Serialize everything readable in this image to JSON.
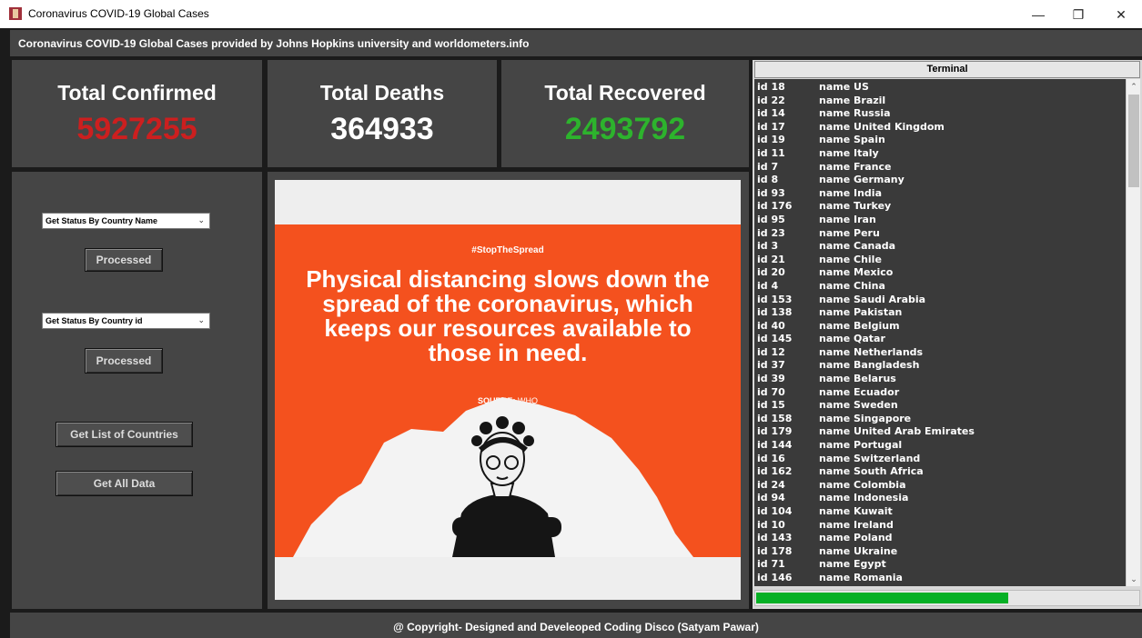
{
  "window": {
    "title": "Coronavirus COVID-19 Global Cases",
    "minimize_glyph": "—",
    "maximize_glyph": "❐",
    "close_glyph": "✕"
  },
  "header": {
    "text": "Coronavirus COVID-19 Global Cases  provided by Johns Hopkins university and worldometers.info"
  },
  "stats": {
    "confirmed": {
      "label": "Total Confirmed",
      "value": "5927255",
      "color": "#cc1f1f"
    },
    "deaths": {
      "label": "Total Deaths",
      "value": "364933",
      "color": "#ffffff"
    },
    "recovered": {
      "label": "Total Recovered",
      "value": "2493792",
      "color": "#2db32d"
    }
  },
  "controls": {
    "country_name_select": "Get Status By Country Name",
    "country_id_select": "Get Status By Country id",
    "processed_label": "Processed",
    "list_countries_label": "Get List of Countries",
    "all_data_label": "Get All Data"
  },
  "poster": {
    "tag": "#StopTheSpread",
    "headline": "Physical distancing slows down the spread of the coronavirus, which keeps our resources available to those in need.",
    "source_label": "SOURCE:",
    "source_value": "WHO"
  },
  "terminal": {
    "title": "Terminal",
    "rows": [
      {
        "id": "id 18",
        "name": "name US"
      },
      {
        "id": "id 22",
        "name": "name Brazil"
      },
      {
        "id": "id 14",
        "name": "name Russia"
      },
      {
        "id": "id 17",
        "name": "name United Kingdom"
      },
      {
        "id": "id 19",
        "name": "name Spain"
      },
      {
        "id": "id 11",
        "name": "name Italy"
      },
      {
        "id": "id 7",
        "name": "name France"
      },
      {
        "id": "id 8",
        "name": "name Germany"
      },
      {
        "id": "id 93",
        "name": "name India"
      },
      {
        "id": "id 176",
        "name": "name Turkey"
      },
      {
        "id": "id 95",
        "name": "name Iran"
      },
      {
        "id": "id 23",
        "name": "name Peru"
      },
      {
        "id": "id 3",
        "name": "name Canada"
      },
      {
        "id": "id 21",
        "name": "name Chile"
      },
      {
        "id": "id 20",
        "name": "name Mexico"
      },
      {
        "id": "id 4",
        "name": "name China"
      },
      {
        "id": "id 153",
        "name": "name Saudi Arabia"
      },
      {
        "id": "id 138",
        "name": "name Pakistan"
      },
      {
        "id": "id 40",
        "name": "name Belgium"
      },
      {
        "id": "id 145",
        "name": "name Qatar"
      },
      {
        "id": "id 12",
        "name": "name Netherlands"
      },
      {
        "id": "id 37",
        "name": "name Bangladesh"
      },
      {
        "id": "id 39",
        "name": "name Belarus"
      },
      {
        "id": "id 70",
        "name": "name Ecuador"
      },
      {
        "id": "id 15",
        "name": "name Sweden"
      },
      {
        "id": "id 158",
        "name": "name Singapore"
      },
      {
        "id": "id 179",
        "name": "name United Arab Emirates"
      },
      {
        "id": "id 144",
        "name": "name Portugal"
      },
      {
        "id": "id 16",
        "name": "name Switzerland"
      },
      {
        "id": "id 162",
        "name": "name South Africa"
      },
      {
        "id": "id 24",
        "name": "name Colombia"
      },
      {
        "id": "id 94",
        "name": "name Indonesia"
      },
      {
        "id": "id 104",
        "name": "name Kuwait"
      },
      {
        "id": "id 10",
        "name": "name Ireland"
      },
      {
        "id": "id 143",
        "name": "name Poland"
      },
      {
        "id": "id 178",
        "name": "name Ukraine"
      },
      {
        "id": "id 71",
        "name": "name Egypt"
      },
      {
        "id": "id 146",
        "name": "name Romania"
      }
    ],
    "progress": 0.66,
    "progress_color": "#06b025"
  },
  "footer": {
    "text": "@ Copyright- Designed and Develeoped Coding Disco (Satyam Pawar)"
  }
}
